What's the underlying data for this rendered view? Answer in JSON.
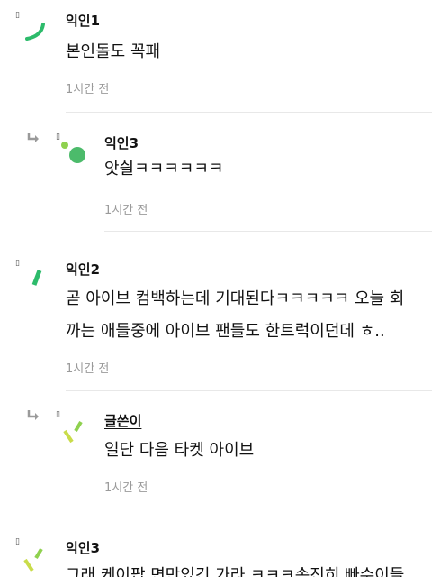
{
  "comments": [
    {
      "author": "익인1",
      "lines": [
        "본인돌도 꼭패"
      ],
      "time": "1시간 전",
      "is_reply": false,
      "is_op": false
    },
    {
      "author": "익인3",
      "lines": [
        "앗싈ㅋㅋㅋㅋㅋㅋ"
      ],
      "time": "1시간 전",
      "is_reply": true,
      "is_op": false
    },
    {
      "author": "익인2",
      "lines": [
        "곧 아이브 컴백하는데 기대된다ㅋㅋㅋㅋㅋ 오늘 회",
        "까는 애들중에 아이브 팬들도 한트럭이던데 ㅎ.."
      ],
      "time": "1시간 전",
      "is_reply": false,
      "is_op": false
    },
    {
      "author": "글쓴이",
      "lines": [
        "일단 다음 타켓 아이브"
      ],
      "time": "1시간 전",
      "is_reply": true,
      "is_op": true
    },
    {
      "author": "익인3",
      "lines": [
        "그래 케이팝 면만있긴 가라 ㅋㅋㅋ속진히 빠수이들"
      ],
      "time": "",
      "is_reply": false,
      "is_op": false
    }
  ],
  "bullet_glyph": "▯",
  "icons": {
    "reply": "reply-arrow-icon",
    "avatar": "anonymous-avatar-icon"
  },
  "colors": {
    "green": "#2dbb6b",
    "light_green": "#8fd14f",
    "yellow_green": "#c9dc4a"
  }
}
